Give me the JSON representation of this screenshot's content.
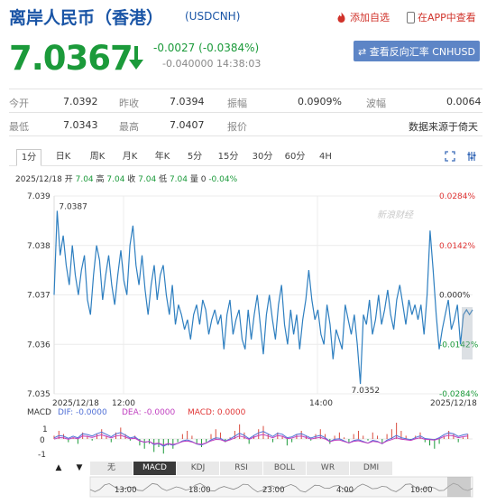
{
  "header": {
    "title": "离岸人民币（香港）",
    "code": "(USDCNH)",
    "add_watch": "添加自选",
    "view_in_app": "在APP中查看"
  },
  "quote": {
    "price": "7.0367",
    "change": "-0.0027 (-0.0384%)",
    "change2": "-0.040000 14:38:03",
    "reverse_btn": "⇄ 查看反向汇率 CNHUSD"
  },
  "stats": [
    [
      {
        "l": "今开",
        "v": "7.0392"
      },
      {
        "l": "昨收",
        "v": "7.0394"
      },
      {
        "l": "振幅",
        "v": "0.0909%"
      },
      {
        "l": "波幅",
        "v": "0.0064"
      }
    ],
    [
      {
        "l": "最低",
        "v": "7.0343"
      },
      {
        "l": "最高",
        "v": "7.0407"
      },
      {
        "l": "报价",
        "v": ""
      },
      {
        "l": "",
        "v": "数据来源于倚天"
      }
    ]
  ],
  "tabs": [
    "1分",
    "日K",
    "周K",
    "月K",
    "年K",
    "5分",
    "15分",
    "30分",
    "60分",
    "4H"
  ],
  "info": {
    "prefix": "2025/12/18 开 ",
    "o": "7.04",
    "h_l": " 高 ",
    "h": "7.04",
    "c_l": " 收 ",
    "c": "7.04",
    "lo_l": " 低 ",
    "lo": "7.04",
    "v_l": " 量 0 ",
    "pct": "-0.04%"
  },
  "watermark": "新浪财经",
  "macd_label": {
    "name": "MACD",
    "dif": "DIF: -0.0000",
    "dea": "DEA: -0.0000",
    "macd": "MACD: 0.0000"
  },
  "indicator_tabs": [
    "无",
    "MACD",
    "KDJ",
    "RSI",
    "BOLL",
    "WR",
    "DMI"
  ],
  "nav": [
    "▲",
    "▼",
    "◀"
  ],
  "chart_data": {
    "type": "line",
    "ylim": [
      7.035,
      7.039
    ],
    "y_ticks": [
      "7.039",
      "7.038",
      "7.037",
      "7.036",
      "7.035"
    ],
    "right_ticks": [
      "0.0284%",
      "0.0142%",
      "0.000%",
      "-0.0142%",
      "-0.0284%"
    ],
    "x_labels": [
      "2025/12/18",
      "12:00",
      "14:00",
      "2025/12/18"
    ],
    "max_label": "7.0387",
    "min_label": "7.0352",
    "values": [
      7.037,
      7.0387,
      7.0378,
      7.0382,
      7.0376,
      7.0372,
      7.038,
      7.0374,
      7.037,
      7.0375,
      7.0378,
      7.0369,
      7.0366,
      7.0374,
      7.038,
      7.0377,
      7.0369,
      7.0374,
      7.0378,
      7.0372,
      7.0368,
      7.0374,
      7.0379,
      7.0373,
      7.037,
      7.038,
      7.0384,
      7.0376,
      7.0372,
      7.0378,
      7.0371,
      7.0366,
      7.0372,
      7.0376,
      7.0369,
      7.0374,
      7.0376,
      7.037,
      7.0366,
      7.0372,
      7.0364,
      7.0368,
      7.0366,
      7.0363,
      7.0365,
      7.0361,
      7.0366,
      7.0368,
      7.0364,
      7.0369,
      7.0367,
      7.0362,
      7.0365,
      7.0367,
      7.0364,
      7.0366,
      7.0359,
      7.0366,
      7.0369,
      7.0362,
      7.0365,
      7.0367,
      7.0361,
      7.0359,
      7.0367,
      7.0361,
      7.0366,
      7.037,
      7.0364,
      7.0358,
      7.0366,
      7.037,
      7.0365,
      7.0361,
      7.0368,
      7.0372,
      7.0364,
      7.036,
      7.0367,
      7.0362,
      7.0366,
      7.0359,
      7.0365,
      7.0369,
      7.0375,
      7.0369,
      7.0365,
      7.0367,
      7.0362,
      7.036,
      7.0368,
      7.0364,
      7.0357,
      7.0363,
      7.0361,
      7.0359,
      7.0368,
      7.0365,
      7.0362,
      7.0366,
      7.036,
      7.0352,
      7.0366,
      7.0364,
      7.0369,
      7.0362,
      7.0365,
      7.037,
      7.0364,
      7.0367,
      7.0371,
      7.0366,
      7.0363,
      7.0369,
      7.0372,
      7.0368,
      7.0364,
      7.0369,
      7.0366,
      7.0368,
      7.0365,
      7.0368,
      7.0362,
      7.037,
      7.0383,
      7.0375,
      7.0366,
      7.0359,
      7.0363,
      7.0366,
      7.0369,
      7.0363,
      7.0365,
      7.0368,
      7.036,
      7.0366,
      7.0367,
      7.0366,
      7.0367
    ]
  },
  "macd_data": {
    "hist": [
      0.2,
      0.5,
      0.3,
      -0.2,
      0.1,
      -0.3,
      0.4,
      0.2,
      -0.1,
      0.3,
      0.6,
      0.2,
      -0.2,
      0.4,
      0.7,
      0.3,
      -0.1,
      0.2,
      -0.4,
      -0.6,
      -0.3,
      -0.8,
      -0.5,
      -0.9,
      -0.4,
      -0.6,
      -0.2,
      0.3,
      0.5,
      0.2,
      -0.3,
      -0.5,
      -0.2,
      0.3,
      0.6,
      0.4,
      -0.2,
      0.1,
      0.5,
      0.9,
      0.4,
      -0.3,
      0.2,
      0.6,
      0.8,
      0.3,
      -0.2,
      0.4,
      0.2,
      -0.4,
      -0.2,
      0.3,
      0.5,
      0.2,
      -0.1,
      0.3,
      0.6,
      0.3,
      -0.3,
      0.2,
      0.4,
      0.1,
      -0.2,
      0.3,
      0.5,
      0.2,
      -0.1,
      0.4,
      0.2,
      -0.3,
      0.3,
      0.6,
      1.0,
      0.5,
      0.2,
      -0.1,
      0.2,
      0.4,
      -0.2,
      -0.4,
      -0.6,
      -0.3,
      0.2,
      0.5,
      0.3,
      -0.2,
      0.1,
      0.3
    ]
  }
}
